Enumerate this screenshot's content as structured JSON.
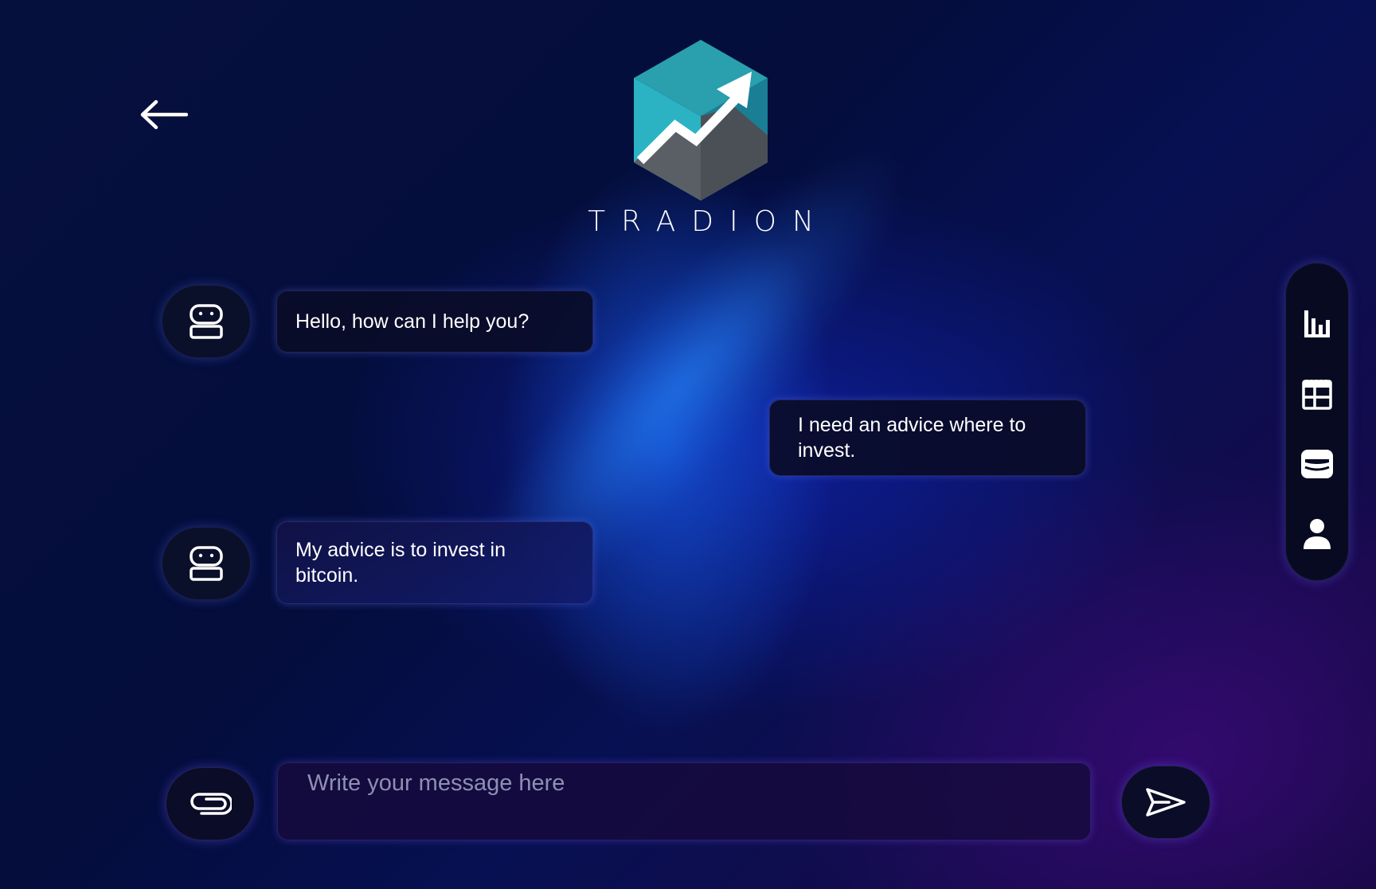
{
  "app": {
    "brand_name": "TRADION",
    "accent_color": "#2fb8c8"
  },
  "header": {
    "back_icon": "arrow-left-icon",
    "logo_icon": "hexagon-trend-up-logo"
  },
  "messages": [
    {
      "sender": "bot",
      "avatar_icon": "robot-icon",
      "text": "Hello, how can I help you?"
    },
    {
      "sender": "user",
      "text": "I need an advice where to invest."
    },
    {
      "sender": "bot",
      "avatar_icon": "robot-icon",
      "text": "My advice is to invest in bitcoin."
    }
  ],
  "composer": {
    "placeholder": "Write your message here",
    "value": "",
    "attach_icon": "paperclip-icon",
    "send_icon": "send-icon"
  },
  "side_nav": {
    "items": [
      {
        "icon": "bar-chart-icon"
      },
      {
        "icon": "calendar-table-icon"
      },
      {
        "icon": "wallet-icon"
      },
      {
        "icon": "user-icon"
      }
    ]
  }
}
